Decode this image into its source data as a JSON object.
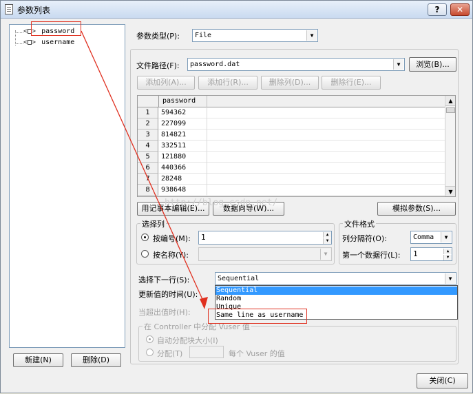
{
  "window": {
    "title": "参数列表",
    "help_label": "?",
    "close_label": "✕"
  },
  "tree": {
    "items": [
      {
        "label": "password",
        "icon": "parameter-icon"
      },
      {
        "label": "username",
        "icon": "parameter-icon"
      }
    ]
  },
  "left_buttons": {
    "new_label": "新建(N)",
    "delete_label": "删除(D)"
  },
  "param_type": {
    "label": "参数类型(P):",
    "value": "File"
  },
  "file_path": {
    "label": "文件路径(F):",
    "value": "password.dat",
    "browse_label": "浏览(B)..."
  },
  "toolbar": {
    "add_col": "添加列(A)...",
    "add_row": "添加行(R)...",
    "del_col": "删除列(D)...",
    "del_row": "删除行(E)..."
  },
  "grid": {
    "column_header": "password",
    "rows": [
      {
        "num": "1",
        "value": "594362"
      },
      {
        "num": "2",
        "value": "227099"
      },
      {
        "num": "3",
        "value": "814821"
      },
      {
        "num": "4",
        "value": "332511"
      },
      {
        "num": "5",
        "value": "121880"
      },
      {
        "num": "6",
        "value": "440366"
      },
      {
        "num": "7",
        "value": "28248"
      },
      {
        "num": "8",
        "value": "938648"
      }
    ]
  },
  "grid_buttons": {
    "notepad": "用记事本编辑(E)...",
    "wizard": "数据向导(W)...",
    "simulate": "模拟参数(S)..."
  },
  "select_column": {
    "title": "选择列",
    "by_number_label": "按编号(M):",
    "by_number_value": "1",
    "by_name_label": "按名称(Y):"
  },
  "file_format": {
    "title": "文件格式",
    "delimiter_label": "列分隔符(O):",
    "delimiter_value": "Comma",
    "first_row_label": "第一个数据行(L):",
    "first_row_value": "1"
  },
  "next_row": {
    "label": "选择下一行(S):",
    "value": "Sequential",
    "options": [
      "Sequential",
      "Random",
      "Unique",
      "Same line as username"
    ],
    "selected_index": 0
  },
  "update_label": "更新值的时间(U):",
  "out_of_values_label": "当超出值时(H):",
  "controller": {
    "title": "在 Controller 中分配 Vuser 值",
    "auto_label": "自动分配块大小(I)",
    "alloc_label": "分配(T)",
    "per_vuser_label": "每个 Vuser 的值"
  },
  "close_button": "关闭(C)",
  "watermark": "http://blog.csdn.net/",
  "colors": {
    "annotation": "#e03020",
    "selection": "#3399ff"
  }
}
